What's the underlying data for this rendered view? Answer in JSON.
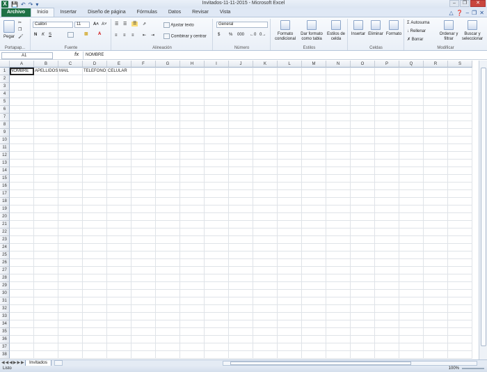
{
  "window": {
    "title": "Invitados-11-11-2015  -  Microsoft Excel"
  },
  "ribbon_tabs": [
    "Archivo",
    "Inicio",
    "Insertar",
    "Diseño de página",
    "Fórmulas",
    "Datos",
    "Revisar",
    "Vista"
  ],
  "ribbon": {
    "paste_label": "Pegar",
    "font_name": "Calibri",
    "font_size": "11",
    "wrap_text": "Ajustar texto",
    "merge_center": "Combinar y centrar",
    "number_format": "General",
    "conditional_format": "Formato condicional",
    "format_as_table": "Dar formato como tabla",
    "cell_styles": "Estilos de celda",
    "insert": "Insertar",
    "delete": "Eliminar",
    "format": "Formato",
    "autosum": "Autosuma",
    "fill": "Rellenar",
    "clear": "Borrar",
    "sort_filter": "Ordenar y filtrar",
    "find_select": "Buscar y seleccionar",
    "groups": {
      "clipboard": "Portapap...",
      "font": "Fuente",
      "alignment": "Alineación",
      "number": "Número",
      "styles": "Estilos",
      "cells": "Celdas",
      "editing": "Modificar"
    }
  },
  "formula_bar": {
    "name_box": "A1",
    "fx": "fx",
    "content": "NOMBRE"
  },
  "columns": [
    "A",
    "B",
    "C",
    "D",
    "E",
    "F",
    "G",
    "H",
    "I",
    "J",
    "K",
    "L",
    "M",
    "N",
    "O",
    "P",
    "Q",
    "R",
    "S"
  ],
  "rows": [
    "1",
    "2",
    "3",
    "4",
    "5",
    "6",
    "7",
    "8",
    "9",
    "10",
    "11",
    "12",
    "13",
    "14",
    "15",
    "16",
    "17",
    "18",
    "19",
    "20",
    "21",
    "22",
    "23",
    "24",
    "25",
    "26",
    "27",
    "28",
    "29",
    "30",
    "31",
    "32",
    "33",
    "34",
    "35",
    "36",
    "37",
    "38"
  ],
  "cells": {
    "A1": "NOMBRE",
    "B1": "APELLIDOS",
    "C1": "MAIL",
    "D1": "TELEFONO",
    "E1": "CELULAR"
  },
  "sheet_tabs": [
    "Invitados"
  ],
  "status": {
    "text": "Listo",
    "zoom": "100%"
  }
}
